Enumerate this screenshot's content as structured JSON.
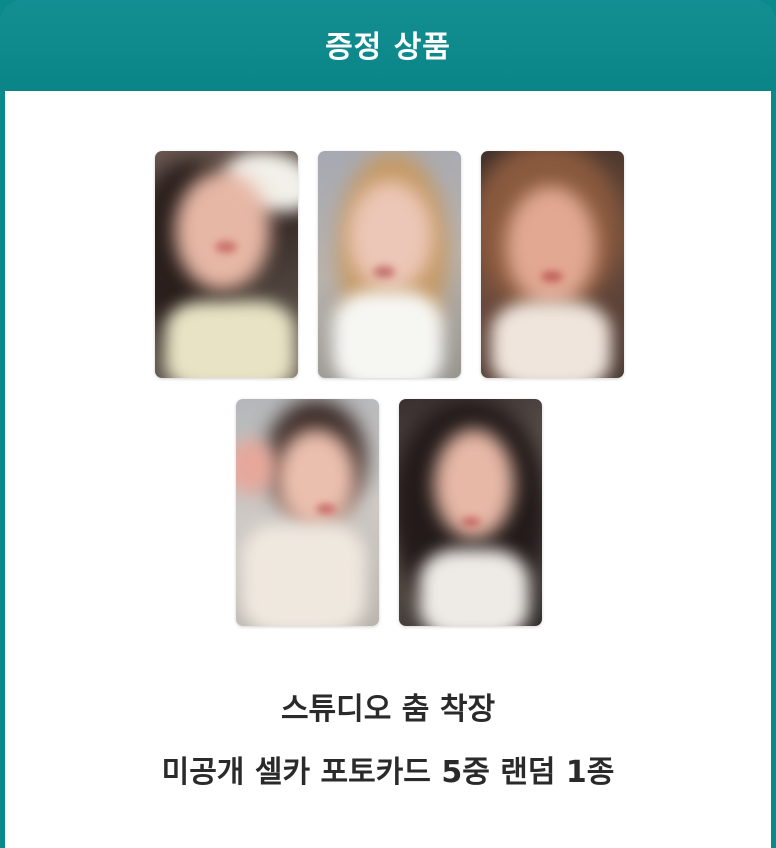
{
  "header": {
    "title": "증정 상품"
  },
  "gift": {
    "line1": "스튜디오 춤 착장",
    "line2": "미공개 셀카 포토카드 5중 랜덤 1종"
  },
  "photocards": [
    {
      "icon": "photo-icon"
    },
    {
      "icon": "photo-icon"
    },
    {
      "icon": "photo-icon"
    },
    {
      "icon": "photo-icon"
    },
    {
      "icon": "photo-icon"
    }
  ],
  "colors": {
    "header_teal": "#0b8a8c",
    "text": "#2a2a2a",
    "panel": "#ffffff"
  }
}
